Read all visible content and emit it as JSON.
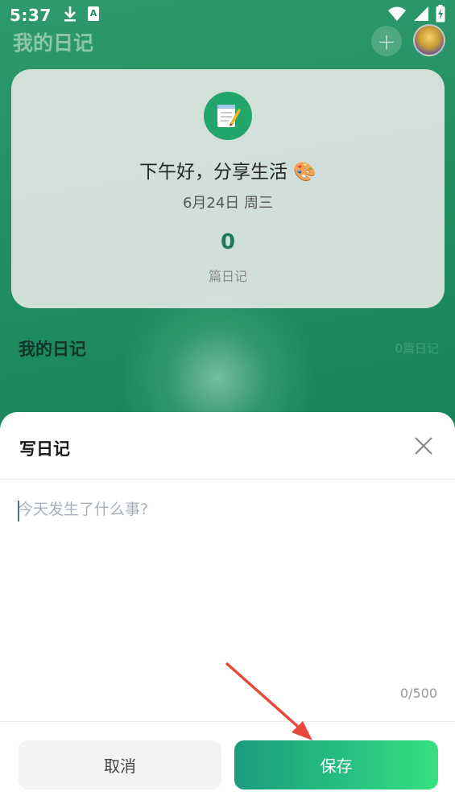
{
  "status_bar": {
    "time": "5:37",
    "icons": [
      "download-icon",
      "a-keyboard-icon",
      "wifi-icon",
      "signal-icon",
      "battery-charging-icon"
    ]
  },
  "app": {
    "title": "我的日记",
    "plus_icon": "plus-icon"
  },
  "summary": {
    "greeting": "下午好，分享生活 🎨",
    "date": "6月24日 周三",
    "count": "0",
    "count_label": "篇日记"
  },
  "section": {
    "title": "我的日记",
    "link": "0篇日记"
  },
  "sheet": {
    "title": "写日记",
    "input_placeholder": "今天发生了什么事?",
    "char_count": "0/500",
    "cancel_label": "取消",
    "save_label": "保存"
  },
  "colors": {
    "accent_start": "#1c9c7d",
    "accent_end": "#36e17e",
    "count_color": "#1d7a5a",
    "arrow": "#e64a3b"
  }
}
